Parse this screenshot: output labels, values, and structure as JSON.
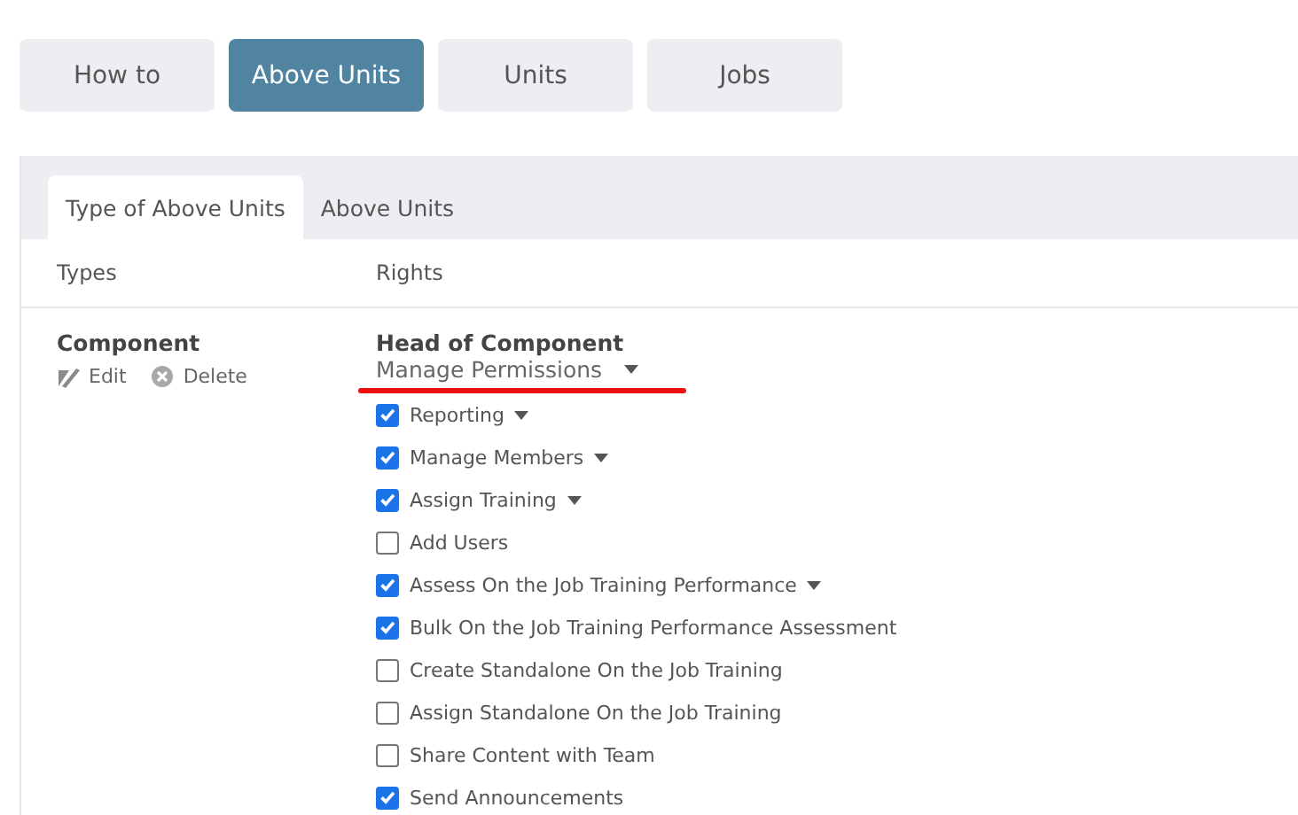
{
  "top_tabs": [
    {
      "label": "How to",
      "selected": false
    },
    {
      "label": "Above Units",
      "selected": true
    },
    {
      "label": "Units",
      "selected": false
    },
    {
      "label": "Jobs",
      "selected": false
    }
  ],
  "sub_tabs": [
    {
      "label": "Type of Above Units",
      "selected": true
    },
    {
      "label": "Above Units",
      "selected": false
    }
  ],
  "table": {
    "columns": [
      "Types",
      "Rights"
    ],
    "rows": [
      {
        "type": "Component",
        "actions": [
          {
            "kind": "edit",
            "label": "Edit"
          },
          {
            "kind": "delete",
            "label": "Delete"
          }
        ],
        "role": "Head of Component",
        "menu": {
          "label": "Manage Permissions",
          "underlined": true
        },
        "permissions": [
          {
            "label": "Reporting",
            "checked": true,
            "has_menu": true
          },
          {
            "label": "Manage Members",
            "checked": true,
            "has_menu": true
          },
          {
            "label": "Assign Training",
            "checked": true,
            "has_menu": true
          },
          {
            "label": "Add Users",
            "checked": false,
            "has_menu": false
          },
          {
            "label": "Assess On the Job Training Performance",
            "checked": true,
            "has_menu": true
          },
          {
            "label": "Bulk On the Job Training Performance Assessment",
            "checked": true,
            "has_menu": false
          },
          {
            "label": "Create Standalone On the Job Training",
            "checked": false,
            "has_menu": false
          },
          {
            "label": "Assign Standalone On the Job Training",
            "checked": false,
            "has_menu": false
          },
          {
            "label": "Share Content with Team",
            "checked": false,
            "has_menu": false
          },
          {
            "label": "Send Announcements",
            "checked": true,
            "has_menu": false
          }
        ]
      }
    ]
  }
}
